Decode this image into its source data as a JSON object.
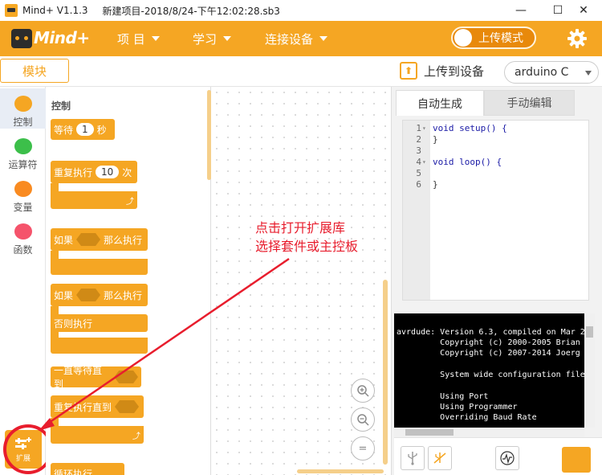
{
  "titlebar": {
    "app_name": "Mind+ V1.1.3",
    "file_name": "新建项目-2018/8/24-下午12:02:28.sb3",
    "minimize": "—",
    "maximize": "☐",
    "close": "✕"
  },
  "menubar": {
    "logo_text": "Mind+",
    "items": [
      {
        "label": "项 目"
      },
      {
        "label": "学习"
      },
      {
        "label": "连接设备"
      }
    ],
    "upload_mode_label": "上传模式",
    "settings_icon": "gear-icon"
  },
  "toolbar": {
    "blocks_tab": "模块",
    "upload_to_device": "上传到设备",
    "device": "arduino C"
  },
  "categories": [
    {
      "label": "控制",
      "color": "#f5a623"
    },
    {
      "label": "运算符",
      "color": "#3cbf4a"
    },
    {
      "label": "变量",
      "color": "#f98b21"
    },
    {
      "label": "函数",
      "color": "#f5536b"
    }
  ],
  "extension": {
    "label": "扩展"
  },
  "palette": {
    "heading": "控制",
    "wait_label": "等待",
    "wait_value": "1",
    "wait_unit": "秒",
    "repeat_label": "重复执行",
    "repeat_value": "10",
    "repeat_unit": "次",
    "if_label": "如果",
    "then_label": "那么执行",
    "if2_label": "如果",
    "then2_label": "那么执行",
    "else_label": "否则执行",
    "wait_until_label": "一直等待直到",
    "repeat_until_label": "重复执行直到",
    "loop_label": "循环执行"
  },
  "workspace": {
    "annotation_line1": "点击打开扩展库",
    "annotation_line2": "选择套件或主控板",
    "zoom_in": "+",
    "zoom_out": "−",
    "reset": "="
  },
  "code_panel": {
    "tab_auto": "自动生成",
    "tab_manual": "手动编辑",
    "lines": [
      {
        "n": "1",
        "code": "void setup() {"
      },
      {
        "n": "2",
        "code": "}"
      },
      {
        "n": "3",
        "code": ""
      },
      {
        "n": "4",
        "code": "void loop() {"
      },
      {
        "n": "5",
        "code": ""
      },
      {
        "n": "6",
        "code": "}"
      }
    ]
  },
  "console": {
    "lines": [
      "avrdude: Version 6.3, compiled on Mar 2",
      "         Copyright (c) 2000-2005 Brian",
      "         Copyright (c) 2007-2014 Joerg",
      "",
      "         System wide configuration file",
      "",
      "         Using Port",
      "         Using Programmer",
      "         Overriding Baud Rate"
    ]
  }
}
